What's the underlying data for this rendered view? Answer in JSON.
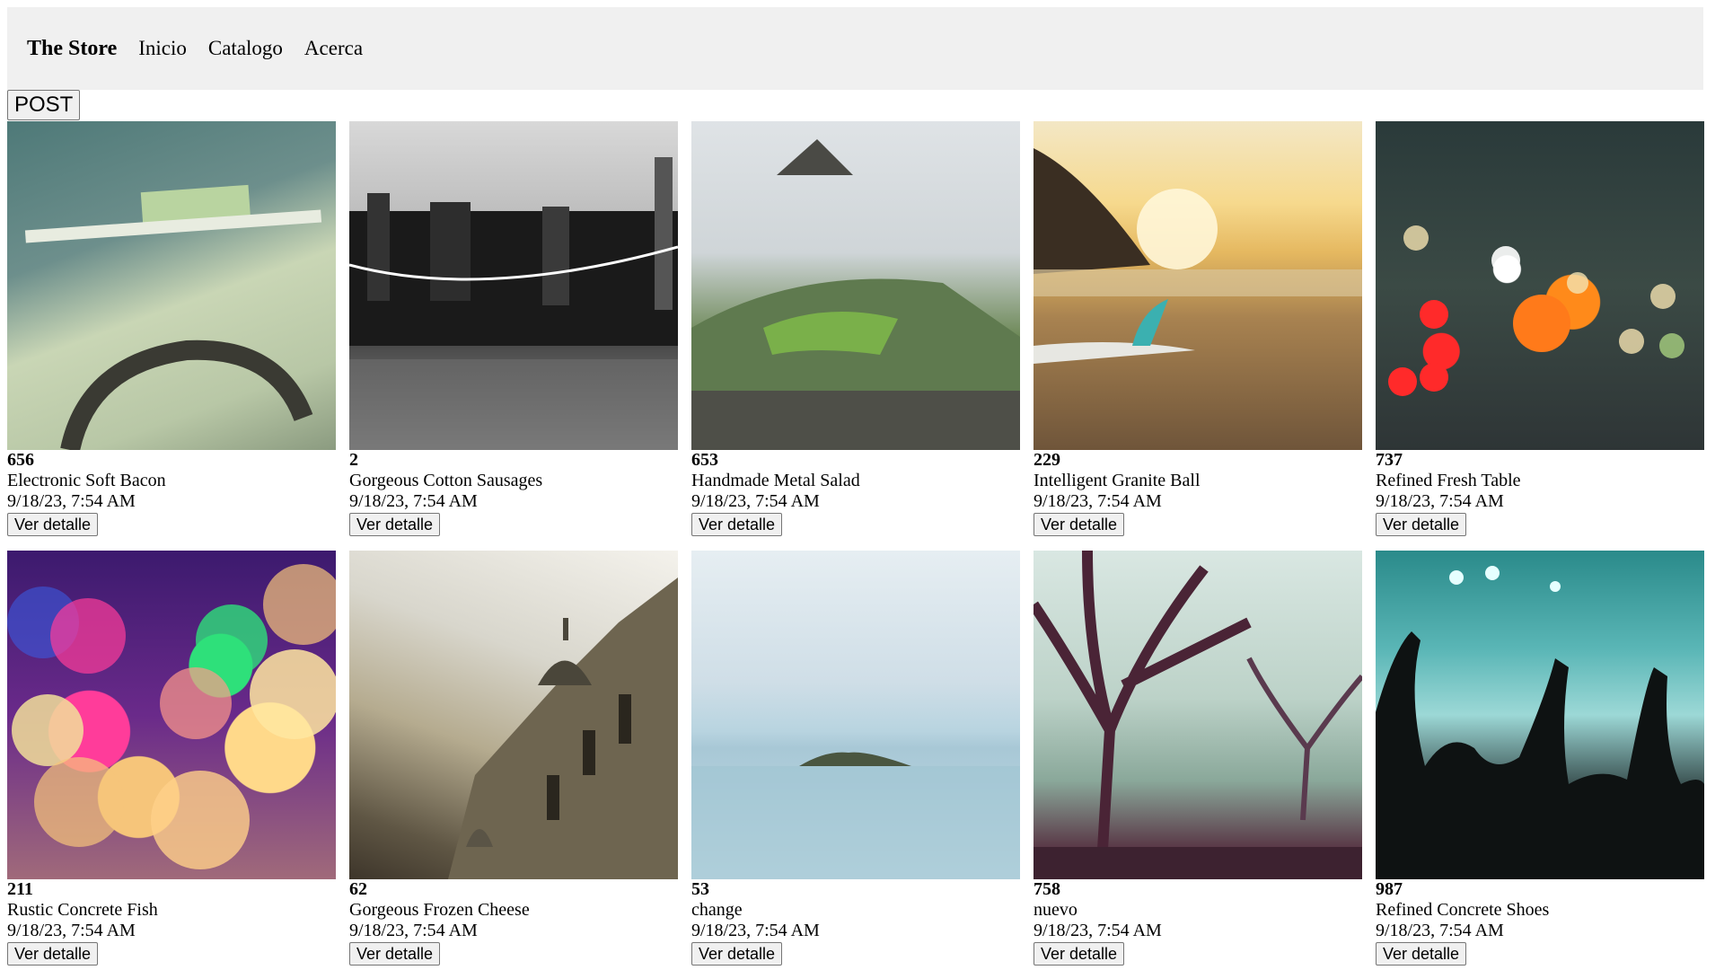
{
  "navbar": {
    "brand": "The Store",
    "links": [
      "Inicio",
      "Catalogo",
      "Acerca"
    ]
  },
  "post_button": "POST",
  "products": [
    {
      "id": "656",
      "name": "Electronic Soft Bacon",
      "date": "9/18/23, 7:54 AM",
      "button": "Ver detalle",
      "image": "desk-drawing-photo"
    },
    {
      "id": "2",
      "name": "Gorgeous Cotton Sausages",
      "date": "9/18/23, 7:54 AM",
      "button": "Ver detalle",
      "image": "brooklyn-bridge-photo"
    },
    {
      "id": "653",
      "name": "Handmade Metal Salad",
      "date": "9/18/23, 7:54 AM",
      "button": "Ver detalle",
      "image": "mountain-ruins-photo"
    },
    {
      "id": "229",
      "name": "Intelligent Granite Ball",
      "date": "9/18/23, 7:54 AM",
      "button": "Ver detalle",
      "image": "beach-surfboard-photo"
    },
    {
      "id": "737",
      "name": "Refined Fresh Table",
      "date": "9/18/23, 7:54 AM",
      "button": "Ver detalle",
      "image": "city-bokeh-photo"
    },
    {
      "id": "211",
      "name": "Rustic Concrete Fish",
      "date": "9/18/23, 7:54 AM",
      "button": "Ver detalle",
      "image": "color-bokeh-photo"
    },
    {
      "id": "62",
      "name": "Gorgeous Frozen Cheese",
      "date": "9/18/23, 7:54 AM",
      "button": "Ver detalle",
      "image": "palace-dome-photo"
    },
    {
      "id": "53",
      "name": "change",
      "date": "9/18/23, 7:54 AM",
      "button": "Ver detalle",
      "image": "sea-island-photo"
    },
    {
      "id": "758",
      "name": "nuevo",
      "date": "9/18/23, 7:54 AM",
      "button": "Ver detalle",
      "image": "foggy-trees-photo"
    },
    {
      "id": "987",
      "name": "Refined Concrete Shoes",
      "date": "9/18/23, 7:54 AM",
      "button": "Ver detalle",
      "image": "concert-crowd-photo"
    }
  ],
  "colors": {
    "navbar_bg": "#f0f0f0",
    "button_bg": "#f0f0f0",
    "button_border": "#767676"
  }
}
